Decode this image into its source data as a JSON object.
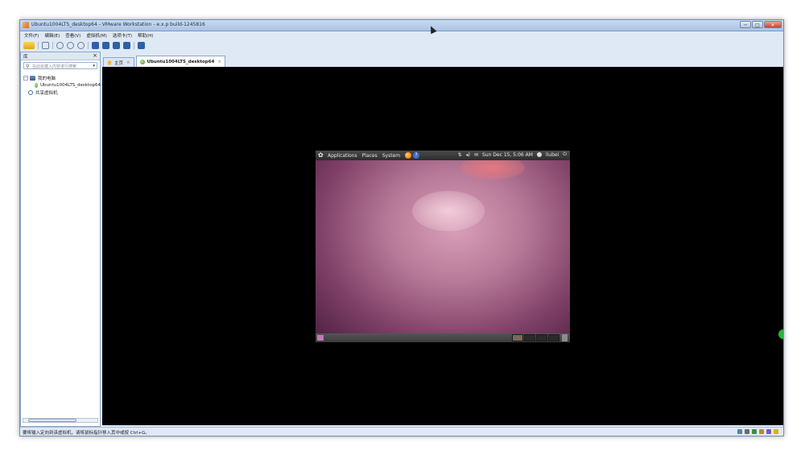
{
  "window": {
    "title": "Ubuntu1004LTS_desktop64 - VMware Workstation - e.x.p build-1245816",
    "minimize": "─",
    "maximize": "□",
    "close": "✕"
  },
  "menubar": {
    "items": [
      "文件(F)",
      "编辑(E)",
      "查看(V)",
      "虚拟机(M)",
      "选项卡(T)",
      "帮助(H)"
    ]
  },
  "library": {
    "title": "库",
    "close": "×",
    "search_placeholder": "在此处键入内容进行搜索",
    "search_caret": "▾",
    "tree": {
      "expander": "−",
      "my_computer": "我的电脑",
      "vm_item": "Ubuntu1004LTS_desktop64",
      "shared": "共享虚拟机"
    }
  },
  "tabs": [
    {
      "label": "主页",
      "close": "×"
    },
    {
      "label": "Ubuntu1004LTS_desktop64",
      "close": "×"
    }
  ],
  "guest": {
    "panel_menus": [
      "Applications",
      "Places",
      "System"
    ],
    "help": "?",
    "datetime": "Sun Dec 15,  5:06 AM",
    "user": "liubei",
    "power": "⏻",
    "network": "⇅",
    "volume": "◂)",
    "mail": "✉"
  },
  "statusbar": {
    "text": "要将输入定向到该虚拟机，请将鼠标指针移入其中或按 Ctrl+G。"
  },
  "colors": {
    "console_bg": "#000000",
    "chrome": "#dfe9f5",
    "accent_green": "#2bb33a"
  }
}
